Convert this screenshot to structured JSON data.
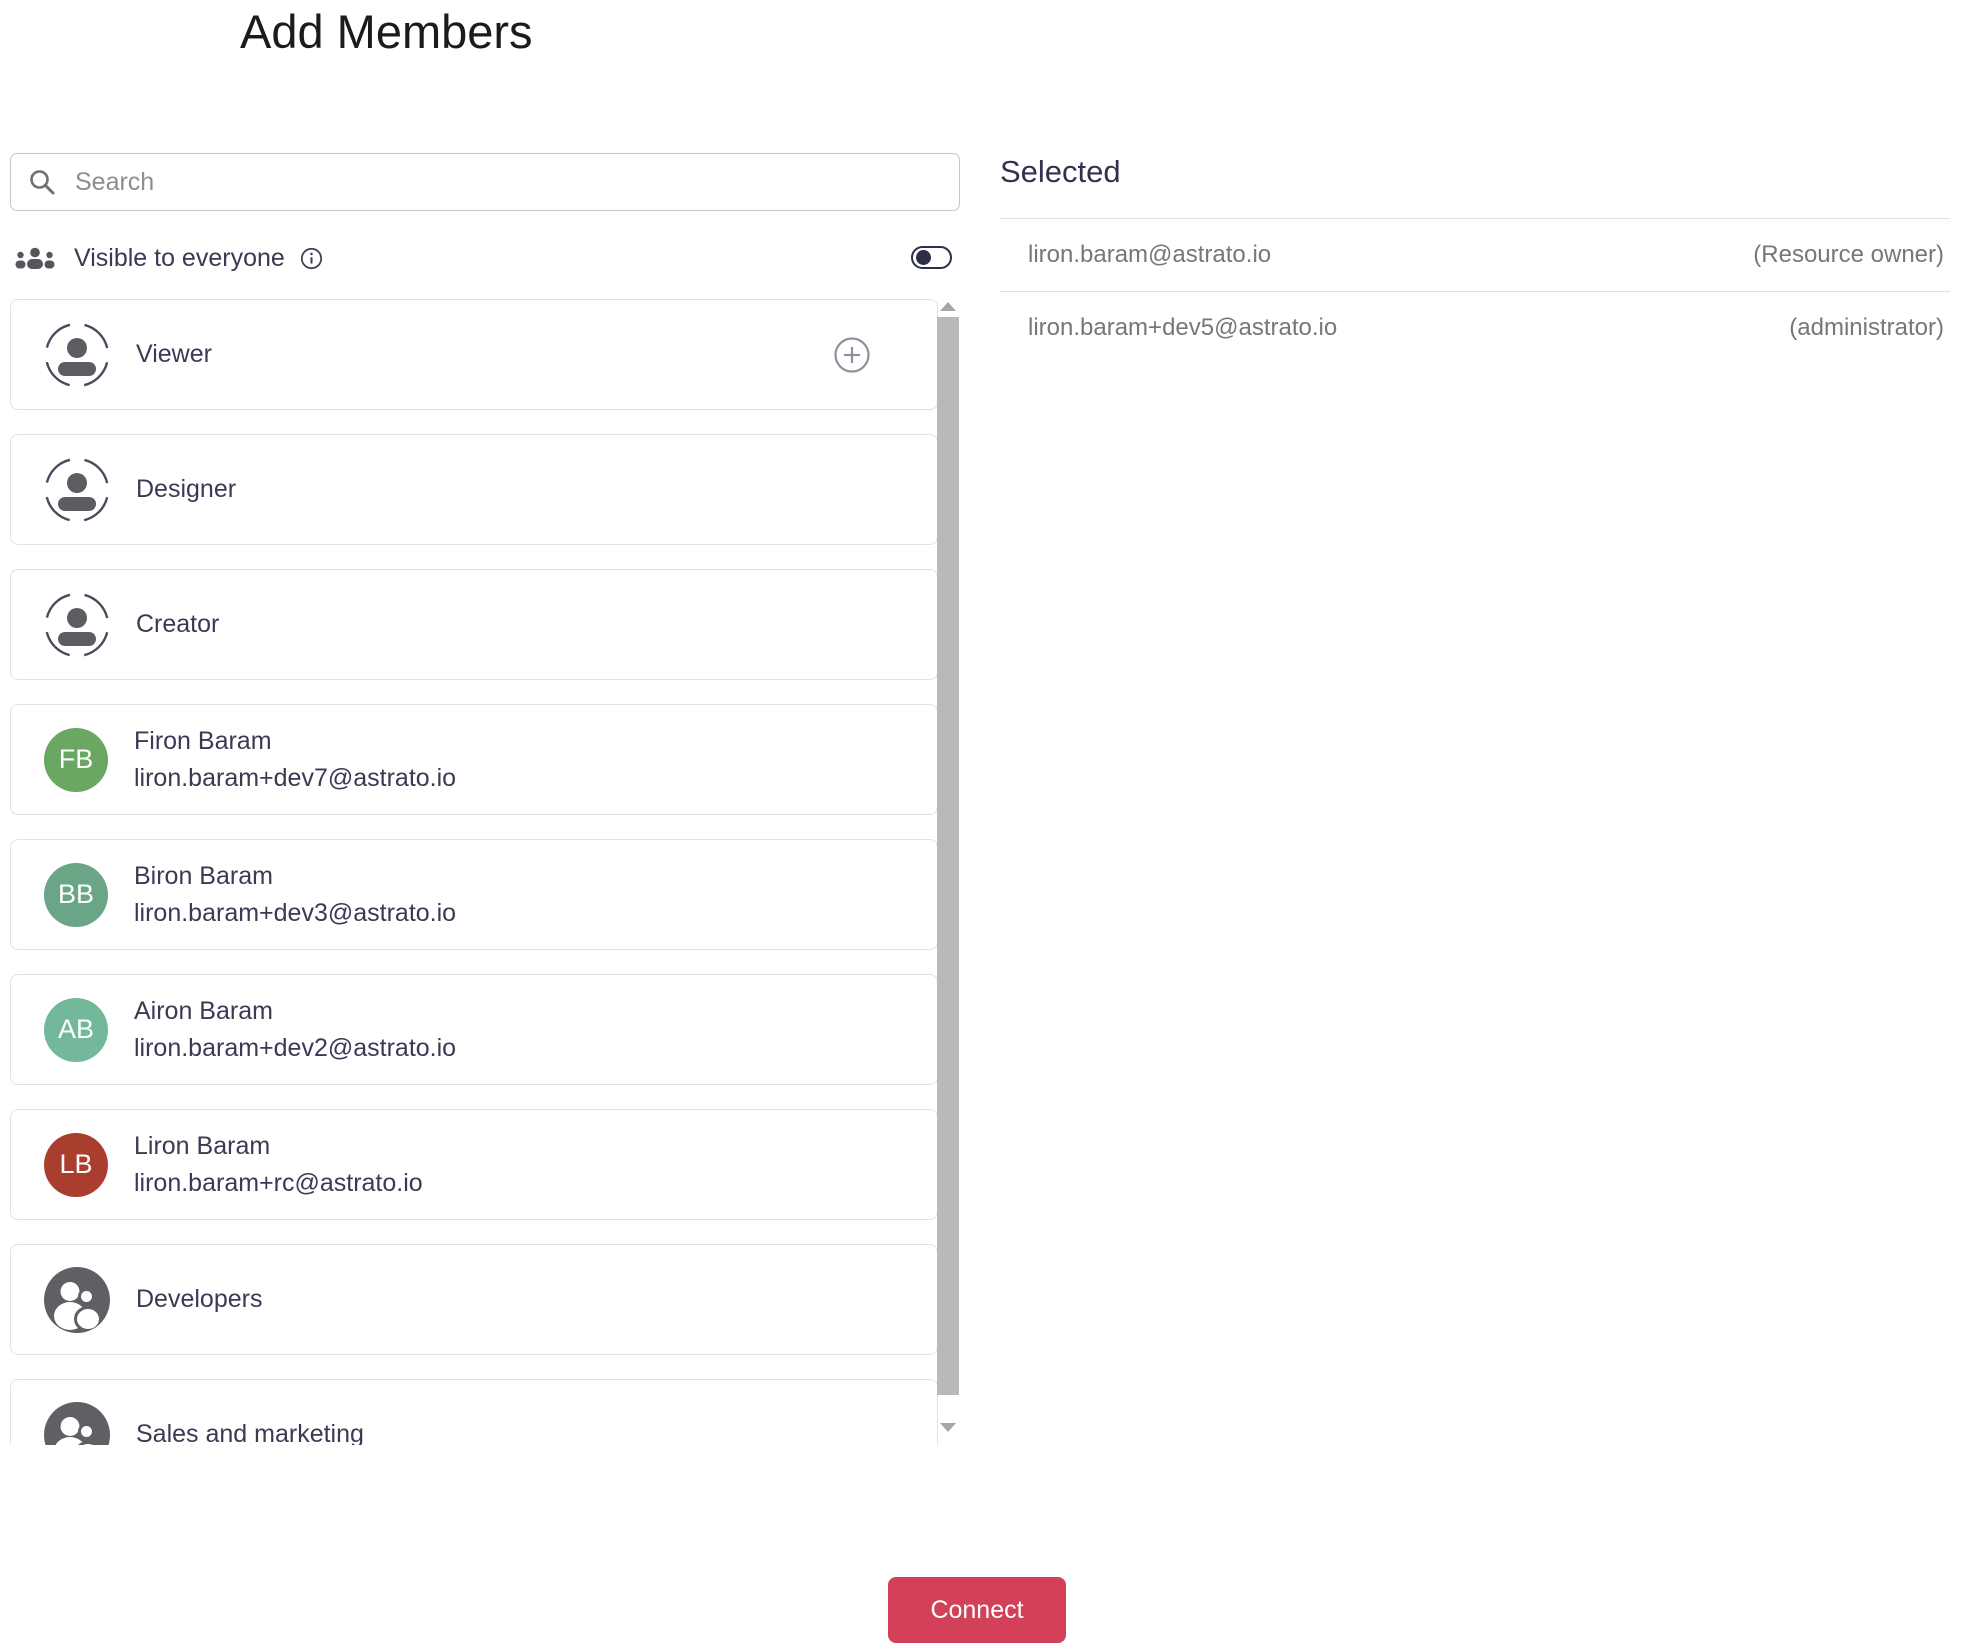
{
  "page": {
    "title": "Add Members"
  },
  "search": {
    "placeholder": "Search",
    "value": ""
  },
  "visibility": {
    "label": "Visible to everyone",
    "state": "off"
  },
  "member_list": {
    "items": [
      {
        "kind": "role",
        "label": "Viewer",
        "has_add_button": true
      },
      {
        "kind": "role",
        "label": "Designer"
      },
      {
        "kind": "role",
        "label": "Creator"
      },
      {
        "kind": "user",
        "label": "Firon Baram",
        "sublabel": "liron.baram+dev7@astrato.io",
        "initials": "FB",
        "avatar_color": "#6aa763"
      },
      {
        "kind": "user",
        "label": "Biron Baram",
        "sublabel": "liron.baram+dev3@astrato.io",
        "initials": "BB",
        "avatar_color": "#6aa586"
      },
      {
        "kind": "user",
        "label": "Airon Baram",
        "sublabel": "liron.baram+dev2@astrato.io",
        "initials": "AB",
        "avatar_color": "#74b89c"
      },
      {
        "kind": "user",
        "label": "Liron Baram",
        "sublabel": "liron.baram+rc@astrato.io",
        "initials": "LB",
        "avatar_color": "#a93e2e"
      },
      {
        "kind": "group",
        "label": "Developers"
      },
      {
        "kind": "group",
        "label": "Sales and marketing"
      }
    ]
  },
  "selected": {
    "heading": "Selected",
    "rows": [
      {
        "email": "liron.baram@astrato.io",
        "role": "(Resource owner)"
      },
      {
        "email": "liron.baram+dev5@astrato.io",
        "role": "(administrator)"
      }
    ]
  },
  "footer": {
    "connect_label": "Connect"
  },
  "colors": {
    "accent_red": "#d24158",
    "toggle_navy": "#2e2e49",
    "text_dark": "#3a3a54",
    "text_gray": "#76767b",
    "icon_gray": "#5c5c63"
  }
}
